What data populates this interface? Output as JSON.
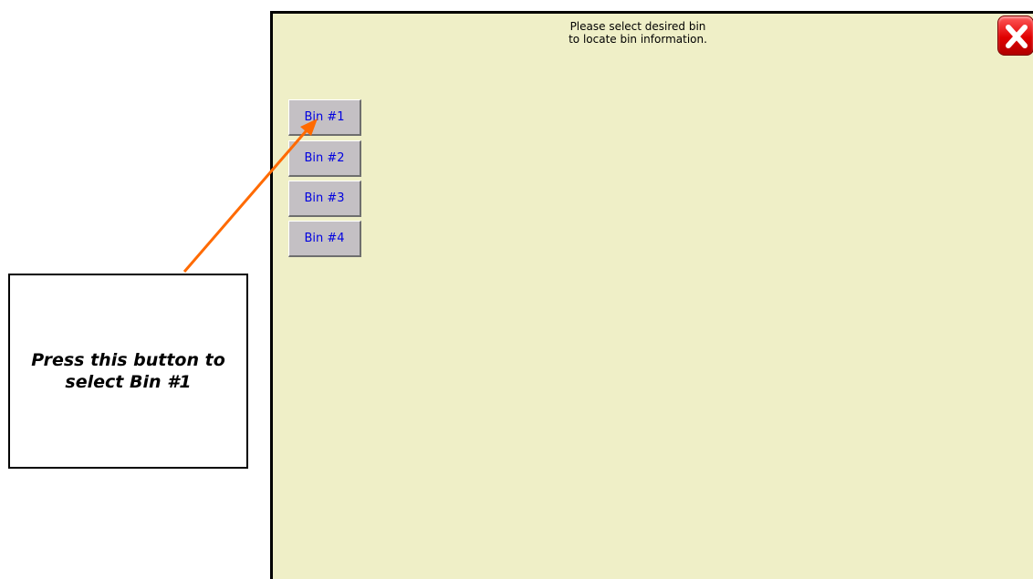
{
  "screen": {
    "instruction_line1": "Please select desired bin",
    "instruction_line2": "to locate bin information.",
    "close_icon": "close-x-icon",
    "bins": [
      {
        "label": "Bin #1"
      },
      {
        "label": "Bin #2"
      },
      {
        "label": "Bin #3"
      },
      {
        "label": "Bin #4"
      }
    ]
  },
  "callout": {
    "line1": "Press this button to",
    "line2": "select Bin #1",
    "arrow_color": "#ff6a00"
  },
  "colors": {
    "panel_background": "#efefc7",
    "button_background": "#c4c0c4",
    "button_text": "#0000e0",
    "close_button": "#e00000"
  }
}
